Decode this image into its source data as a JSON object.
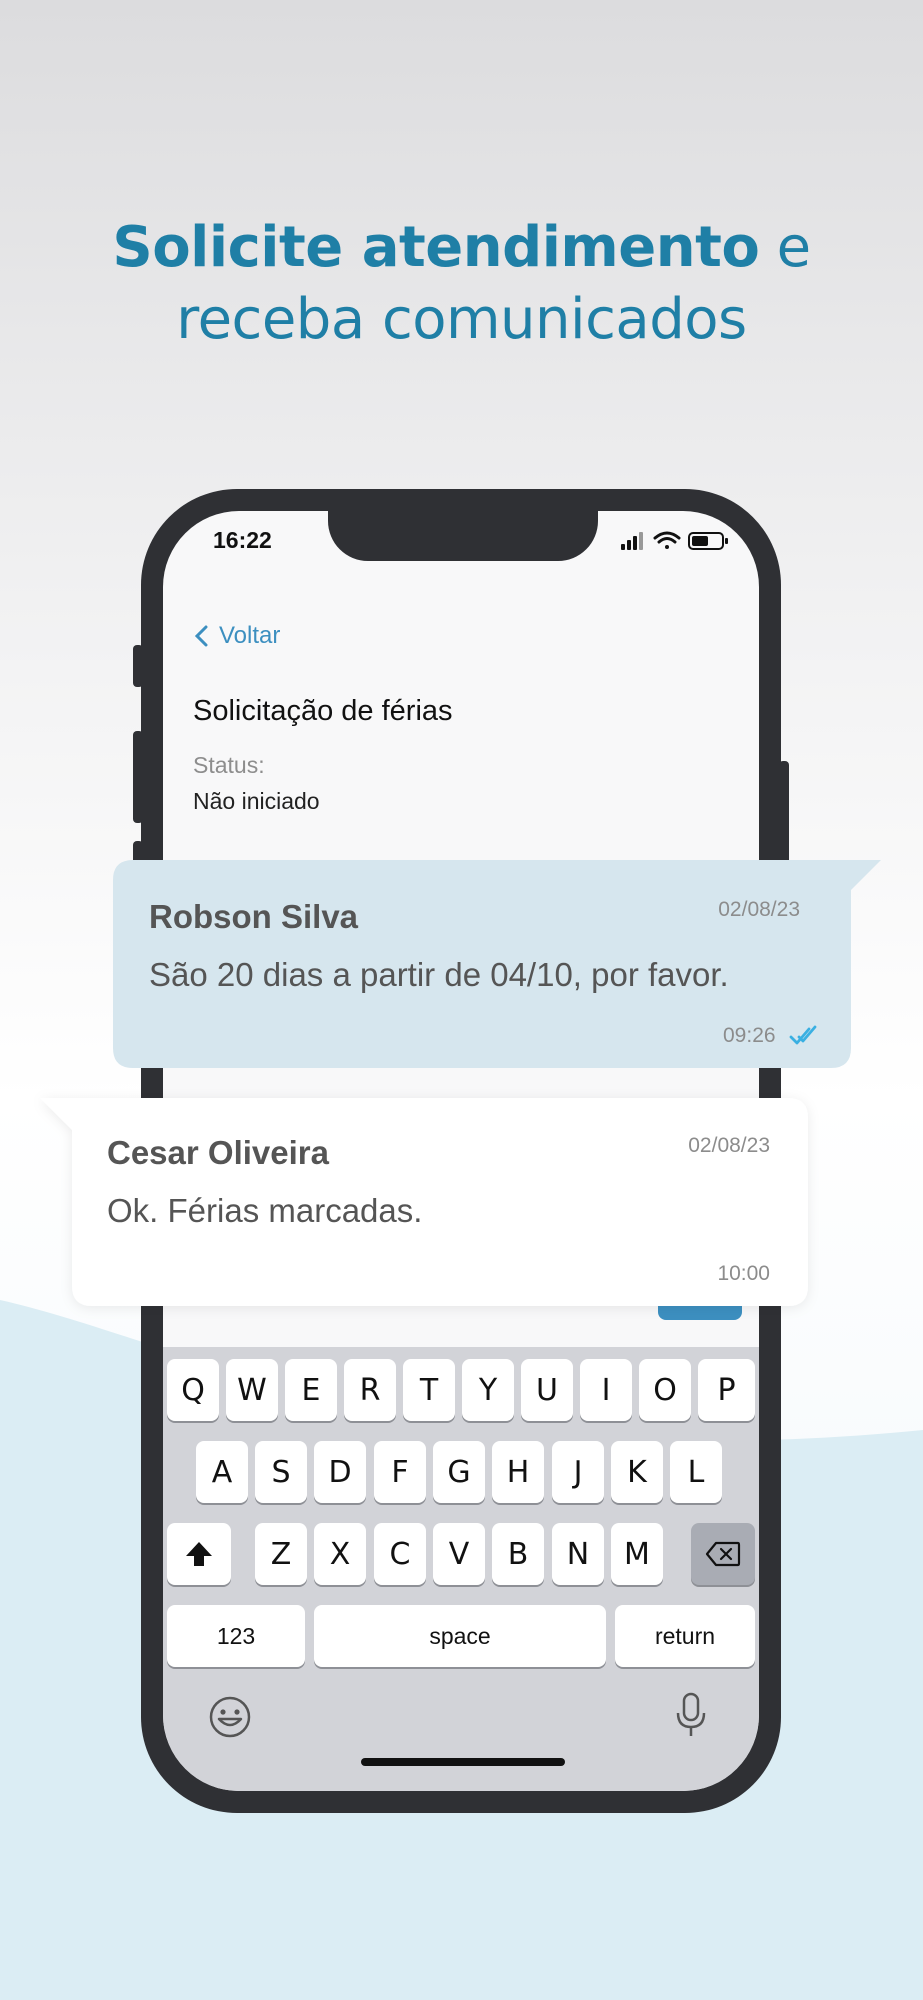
{
  "headline": {
    "bold_part": "Solicite atendimento",
    "rest_line1": " e",
    "line2": "receba comunicados"
  },
  "colors": {
    "accent": "#1f7fa6",
    "link": "#3c8fc0",
    "phone_frame": "#2f3034",
    "incoming_bubble": "#d6e6ee",
    "outgoing_bubble": "#ffffff",
    "read_check": "#3ab0e2"
  },
  "status_bar": {
    "time": "16:22",
    "icons": [
      "signal-icon",
      "wifi-icon",
      "battery-icon"
    ]
  },
  "nav": {
    "back_label": "Voltar"
  },
  "request": {
    "title": "Solicitação de férias",
    "status_label": "Status:",
    "status_value": "Não iniciado"
  },
  "messages": [
    {
      "author": "Robson Silva",
      "date": "02/08/23",
      "text": "São 20 dias a partir de 04/10, por favor.",
      "time": "09:26",
      "read": true
    },
    {
      "author": "Cesar Oliveira",
      "date": "02/08/23",
      "text": "Ok. Férias marcadas.",
      "time": "10:00"
    }
  ],
  "keyboard": {
    "row1": [
      "Q",
      "W",
      "E",
      "R",
      "T",
      "Y",
      "U",
      "I",
      "O",
      "P"
    ],
    "row2": [
      "A",
      "S",
      "D",
      "F",
      "G",
      "H",
      "J",
      "K",
      "L"
    ],
    "row3": [
      "Z",
      "X",
      "C",
      "V",
      "B",
      "N",
      "M"
    ],
    "numbers_label": "123",
    "space_label": "space",
    "return_label": "return",
    "icons": [
      "shift-icon",
      "backspace-icon",
      "emoji-icon",
      "microphone-icon"
    ]
  }
}
